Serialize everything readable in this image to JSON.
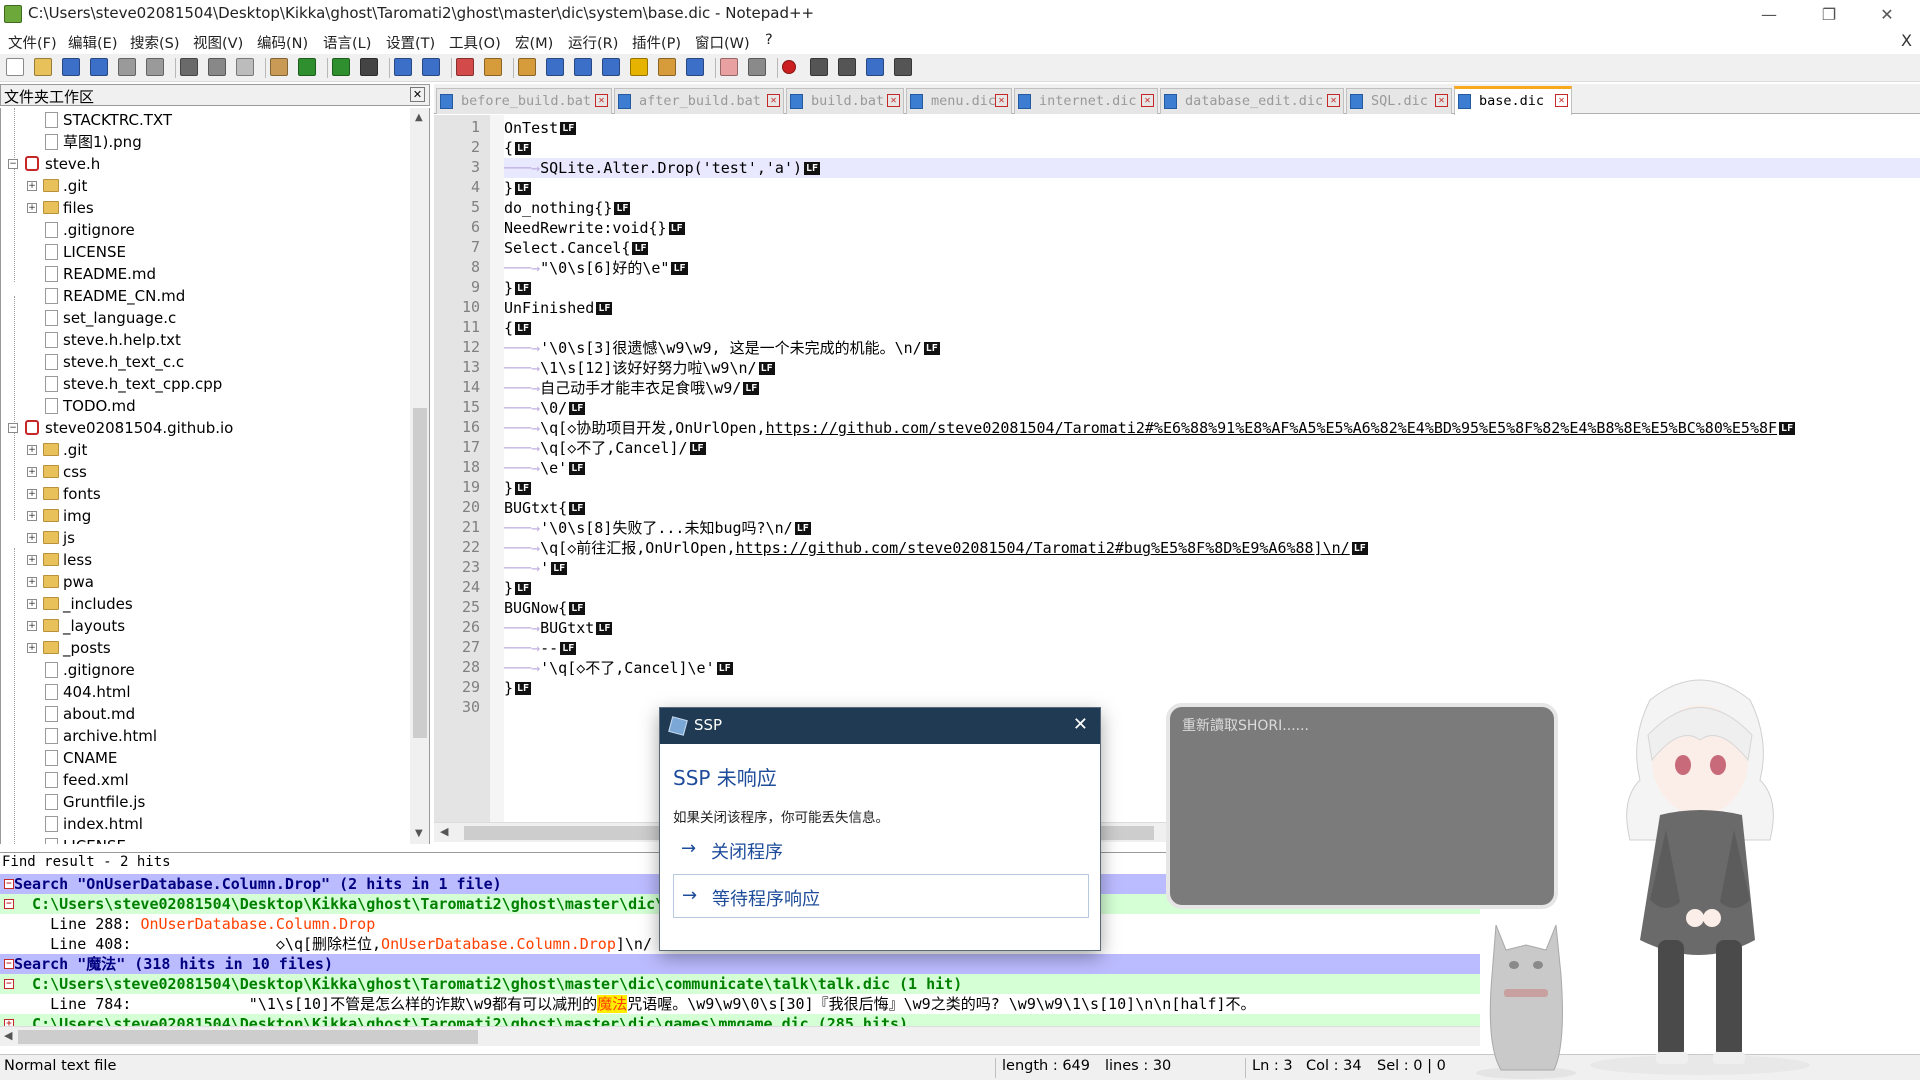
{
  "window": {
    "title": "C:\\Users\\steve02081504\\Desktop\\Kikka\\ghost\\Taromati2\\ghost\\master\\dic\\system\\base.dic - Notepad++",
    "minimize": "—",
    "restore": "❐",
    "close": "✕",
    "doc_close": "X"
  },
  "menu": [
    "文件(F)",
    "编辑(E)",
    "搜索(S)",
    "视图(V)",
    "编码(N)",
    "语言(L)",
    "设置(T)",
    "工具(O)",
    "宏(M)",
    "运行(R)",
    "插件(P)",
    "窗口(W)",
    "?"
  ],
  "toolbar_icons": [
    "new-file-icon",
    "open-file-icon",
    "save-icon",
    "save-all-icon",
    "close-icon",
    "close-all-icon",
    "print-icon",
    "cut-icon",
    "copy-icon",
    "paste-icon",
    "undo-icon",
    "redo-icon",
    "find-icon",
    "replace-icon",
    "zoom-in-icon",
    "zoom-out-icon",
    "sync-v-icon",
    "sync-h-icon",
    "word-wrap-icon",
    "show-all-chars-icon",
    "indent-guide-icon",
    "udl-icon",
    "doc-map-icon",
    "function-list-icon",
    "folder-workspace-icon",
    "monitor-icon",
    "record-macro-icon",
    "stop-record-icon",
    "play-macro-icon",
    "run-macro-multiple-icon",
    "save-macro-icon"
  ],
  "folder_workspace": {
    "title": "文件夹工作区",
    "close": "✕",
    "items": [
      {
        "label": "STACKTRC.TXT",
        "level": 2,
        "kind": "file"
      },
      {
        "label": "草图1).png",
        "level": 2,
        "kind": "file"
      },
      {
        "label": "steve.h",
        "level": 0,
        "kind": "root",
        "expanded": true
      },
      {
        "label": ".git",
        "level": 1,
        "kind": "folder"
      },
      {
        "label": "files",
        "level": 1,
        "kind": "folder"
      },
      {
        "label": ".gitignore",
        "level": 1,
        "kind": "file"
      },
      {
        "label": "LICENSE",
        "level": 1,
        "kind": "file"
      },
      {
        "label": "README.md",
        "level": 1,
        "kind": "file"
      },
      {
        "label": "README_CN.md",
        "level": 1,
        "kind": "file"
      },
      {
        "label": "set_language.c",
        "level": 1,
        "kind": "file"
      },
      {
        "label": "steve.h.help.txt",
        "level": 1,
        "kind": "file"
      },
      {
        "label": "steve.h_text_c.c",
        "level": 1,
        "kind": "file"
      },
      {
        "label": "steve.h_text_cpp.cpp",
        "level": 1,
        "kind": "file"
      },
      {
        "label": "TODO.md",
        "level": 1,
        "kind": "file"
      },
      {
        "label": "steve02081504.github.io",
        "level": 0,
        "kind": "root",
        "expanded": true
      },
      {
        "label": ".git",
        "level": 1,
        "kind": "folder"
      },
      {
        "label": "css",
        "level": 1,
        "kind": "folder"
      },
      {
        "label": "fonts",
        "level": 1,
        "kind": "folder"
      },
      {
        "label": "img",
        "level": 1,
        "kind": "folder"
      },
      {
        "label": "js",
        "level": 1,
        "kind": "folder"
      },
      {
        "label": "less",
        "level": 1,
        "kind": "folder"
      },
      {
        "label": "pwa",
        "level": 1,
        "kind": "folder"
      },
      {
        "label": "_includes",
        "level": 1,
        "kind": "folder"
      },
      {
        "label": "_layouts",
        "level": 1,
        "kind": "folder"
      },
      {
        "label": "_posts",
        "level": 1,
        "kind": "folder"
      },
      {
        "label": ".gitignore",
        "level": 1,
        "kind": "file"
      },
      {
        "label": "404.html",
        "level": 1,
        "kind": "file"
      },
      {
        "label": "about.md",
        "level": 1,
        "kind": "file"
      },
      {
        "label": "archive.html",
        "level": 1,
        "kind": "file"
      },
      {
        "label": "CNAME",
        "level": 1,
        "kind": "file"
      },
      {
        "label": "feed.xml",
        "level": 1,
        "kind": "file"
      },
      {
        "label": "Gruntfile.js",
        "level": 1,
        "kind": "file"
      },
      {
        "label": "index.html",
        "level": 1,
        "kind": "file"
      },
      {
        "label": "LICENSE",
        "level": 1,
        "kind": "file"
      }
    ]
  },
  "tabs": [
    {
      "label": "before_build.bat",
      "active": false
    },
    {
      "label": "after_build.bat",
      "active": false
    },
    {
      "label": "build.bat",
      "active": false
    },
    {
      "label": "menu.dic",
      "active": false
    },
    {
      "label": "internet.dic",
      "active": false
    },
    {
      "label": "database_edit.dic",
      "active": false
    },
    {
      "label": "SQL.dic",
      "active": false
    },
    {
      "label": "base.dic",
      "active": true
    }
  ],
  "editor": {
    "eol_marker": "LF",
    "current_line": 3,
    "lines": [
      {
        "n": "1",
        "tab": false,
        "text": "OnTest"
      },
      {
        "n": "2",
        "tab": false,
        "text": "{"
      },
      {
        "n": "3",
        "tab": true,
        "text": "SQLite.Alter.Drop('test','a')"
      },
      {
        "n": "4",
        "tab": false,
        "text": "}"
      },
      {
        "n": "5",
        "tab": false,
        "text": "do_nothing{}"
      },
      {
        "n": "6",
        "tab": false,
        "text": "NeedRewrite:void{}"
      },
      {
        "n": "7",
        "tab": false,
        "text": "Select.Cancel{"
      },
      {
        "n": "8",
        "tab": true,
        "text": "\"\\0\\s[6]好的\\e\""
      },
      {
        "n": "9",
        "tab": false,
        "text": "}"
      },
      {
        "n": "10",
        "tab": false,
        "text": "UnFinished"
      },
      {
        "n": "11",
        "tab": false,
        "text": "{"
      },
      {
        "n": "12",
        "tab": true,
        "text": "'\\0\\s[3]很遗憾\\w9\\w9, 这是一个未完成的机能。\\n/"
      },
      {
        "n": "13",
        "tab": true,
        "text": "\\1\\s[12]该好好努力啦\\w9\\n/"
      },
      {
        "n": "14",
        "tab": true,
        "text": "自己动手才能丰衣足食哦\\w9/"
      },
      {
        "n": "15",
        "tab": true,
        "text": "\\0/"
      },
      {
        "n": "16",
        "tab": true,
        "text": "\\q[◇协助项目开发,OnUrlOpen,",
        "link": "https://github.com/steve02081504/Taromati2#%E6%88%91%E8%AF%A5%E5%A6%82%E4%BD%95%E5%8F%82%E4%B8%8E%E5%BC%80%E5%8F"
      },
      {
        "n": "17",
        "tab": true,
        "text": "\\q[◇不了,Cancel]/"
      },
      {
        "n": "18",
        "tab": true,
        "text": "\\e'"
      },
      {
        "n": "19",
        "tab": false,
        "text": "}"
      },
      {
        "n": "20",
        "tab": false,
        "text": "BUGtxt{"
      },
      {
        "n": "21",
        "tab": true,
        "text": "'\\0\\s[8]失败了...未知bug吗?\\n/"
      },
      {
        "n": "22",
        "tab": true,
        "text": "\\q[◇前往汇报,OnUrlOpen,",
        "link": "https://github.com/steve02081504/Taromati2#bug%E5%8F%8D%E9%A6%88]\\n/"
      },
      {
        "n": "23",
        "tab": true,
        "text": "'"
      },
      {
        "n": "24",
        "tab": false,
        "text": "}"
      },
      {
        "n": "25",
        "tab": false,
        "text": "BUGNow{"
      },
      {
        "n": "26",
        "tab": true,
        "text": "BUGtxt"
      },
      {
        "n": "27",
        "tab": true,
        "text": "--"
      },
      {
        "n": "28",
        "tab": true,
        "text": "'\\q[◇不了,Cancel]\\e'"
      },
      {
        "n": "29",
        "tab": false,
        "text": "}"
      },
      {
        "n": "30",
        "tab": false,
        "text": "",
        "no_eol": true
      }
    ]
  },
  "find_result": {
    "title": "Find result - 2 hits",
    "rows": [
      {
        "kind": "search",
        "mark": "−",
        "pre": "Search \"OnUserDatabase.Column.Drop\" (2 hits in 1 file)",
        "hit": "",
        "post": ""
      },
      {
        "kind": "file",
        "mark": "−",
        "pre": "  C:\\Users\\steve02081504\\Desktop\\Kikka\\ghost\\Taromati2\\ghost\\master\\dic\\system\\database_edit.dic (2 hits)",
        "hit": "",
        "post": ""
      },
      {
        "kind": "line",
        "mark": "",
        "pre": "    Line 288: ",
        "hit": "OnUserDatabase.Column.Drop",
        "post": ""
      },
      {
        "kind": "line",
        "mark": "",
        "pre": "    Line 408:                ◇\\q[删除栏位,",
        "hit": "OnUserDatabase.Column.Drop",
        "post": "]\\n/"
      },
      {
        "kind": "search",
        "mark": "−",
        "pre": "Search \"魔法\" (318 hits in 10 files)",
        "hit": "",
        "post": ""
      },
      {
        "kind": "file",
        "mark": "−",
        "pre": "  C:\\Users\\steve02081504\\Desktop\\Kikka\\ghost\\Taromati2\\ghost\\master\\dic\\communicate\\talk\\talk.dic (1 hit)",
        "hit": "",
        "post": ""
      },
      {
        "kind": "line",
        "mark": "",
        "pre": "    Line 784:             \"\\1\\s[10]不管是怎么样的诈欺\\w9都有可以减刑的",
        "hit": "魔法",
        "post": "咒语喔。\\w9\\w9\\0\\s[30]『我很后悔』\\w9之类的吗? \\w9\\w9\\1\\s[10]\\n\\n[half]不。",
        "hl": true
      },
      {
        "kind": "file",
        "mark": "+",
        "pre": "  C:\\Users\\steve02081504\\Desktop\\Kikka\\ghost\\Taromati2\\ghost\\master\\dic\\games\\mmgame.dic (285 hits)",
        "hit": "",
        "post": ""
      }
    ]
  },
  "statusbar": {
    "type": "Normal text file",
    "length": "length : 649",
    "lines": "lines : 30",
    "ln": "Ln : 3",
    "col": "Col : 34",
    "sel": "Sel : 0 | 0"
  },
  "dialog": {
    "title": "SSP",
    "heading": "SSP 未响应",
    "message": "如果关闭该程序，你可能丢失信息。",
    "options": [
      {
        "label": "关闭程序",
        "selected": false
      },
      {
        "label": "等待程序响应",
        "selected": true
      }
    ],
    "close": "✕",
    "arrow": "→"
  },
  "balloon": {
    "text": "重新讀取SHORI......"
  },
  "colors": {
    "accent_tab": "#f7a81b",
    "search_row_bg": "#bbbbff",
    "file_row_bg": "#d5ffd5",
    "hit_color": "#ff4000",
    "dialog_title_bg": "#1f3a52",
    "dialog_text": "#1e4c9a",
    "current_line_bg": "#e8e8ff"
  }
}
